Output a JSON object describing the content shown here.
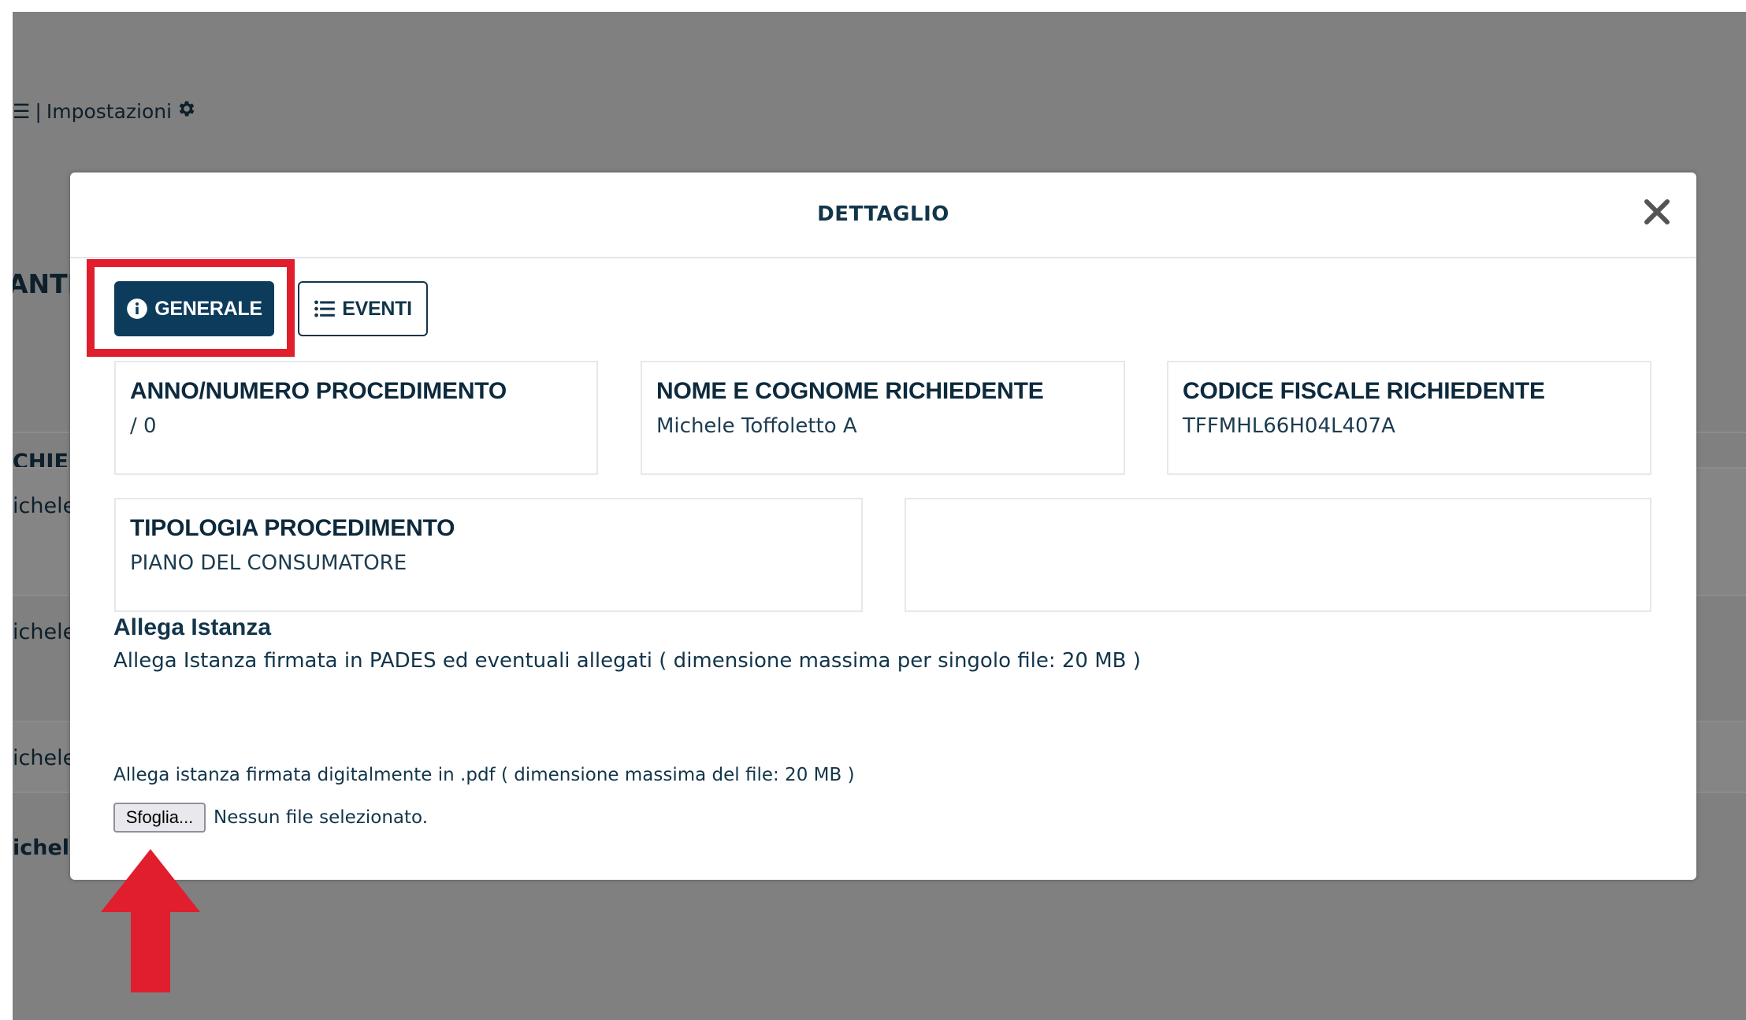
{
  "background": {
    "nav_menu_glyph": "☰",
    "nav_separator": "|",
    "nav_label": "Impostazioni",
    "settings_icon": "gear-icon",
    "section_fragment": "ANTE",
    "column_fragment": "CHIEI",
    "row_fragments": [
      "ichele",
      "ichele",
      "ichele",
      "ichele"
    ]
  },
  "modal": {
    "title": "DETTAGLIO",
    "close_icon": "close-icon",
    "tabs": [
      {
        "label": "GENERALE",
        "icon": "info-circle-icon",
        "active": true
      },
      {
        "label": "EVENTI",
        "icon": "list-icon",
        "active": false
      }
    ],
    "fields": [
      {
        "label": "ANNO/NUMERO PROCEDIMENTO",
        "value": "/ 0"
      },
      {
        "label": "NOME E COGNOME RICHIEDENTE",
        "value": "Michele Toffoletto A"
      },
      {
        "label": "CODICE FISCALE RICHIEDENTE",
        "value": "TFFMHL66H04L407A"
      },
      {
        "label": "TIPOLOGIA PROCEDIMENTO",
        "value": "PIANO DEL CONSUMATORE"
      }
    ],
    "attachment": {
      "title": "Allega Istanza",
      "description": "Allega Istanza firmata in PADES ed eventuali allegati ( dimensione massima per singolo file: 20 MB )",
      "file_hint": "Allega istanza firmata digitalmente in .pdf ( dimensione massima del file: 20 MB )",
      "browse_label": "Sfoglia...",
      "file_status": "Nessun file selezionato."
    }
  },
  "annotations": {
    "highlight_color": "#e01e2d",
    "arrow_color": "#e01e2d"
  },
  "colors": {
    "primary": "#0d3b5c",
    "text": "#12354a",
    "overlay": "#808080"
  }
}
